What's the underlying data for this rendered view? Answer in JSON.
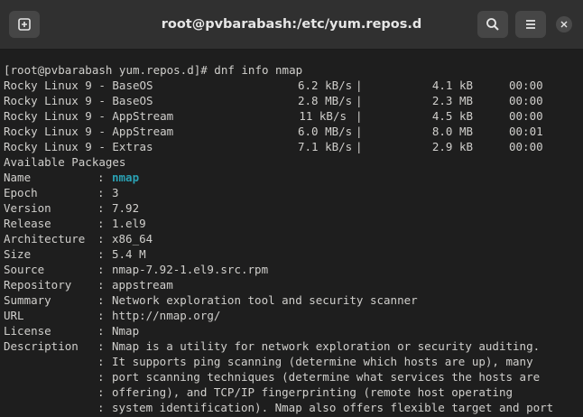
{
  "window": {
    "title": "root@pvbarabash:/etc/yum.repos.d"
  },
  "header_buttons": {
    "new_tab_icon": "new-tab-icon",
    "search_icon": "search-icon",
    "menu_icon": "hamburger-menu-icon",
    "close_icon": "close-icon"
  },
  "terminal": {
    "prompt_line": "[root@pvbarabash yum.repos.d]# dnf info nmap",
    "repos": [
      {
        "name": "Rocky Linux 9 - BaseOS",
        "speed": "6.2 kB/s",
        "sep": "|",
        "size": "4.1 kB",
        "time": "00:00"
      },
      {
        "name": "Rocky Linux 9 - BaseOS",
        "speed": "2.8 MB/s",
        "sep": "|",
        "size": "2.3 MB",
        "time": "00:00"
      },
      {
        "name": "Rocky Linux 9 - AppStream",
        "speed": "11 kB/s",
        "sep": "|",
        "size": "4.5 kB",
        "time": "00:00"
      },
      {
        "name": "Rocky Linux 9 - AppStream",
        "speed": "6.0 MB/s",
        "sep": "|",
        "size": "8.0 MB",
        "time": "00:01"
      },
      {
        "name": "Rocky Linux 9 - Extras",
        "speed": "7.1 kB/s",
        "sep": "|",
        "size": "2.9 kB",
        "time": "00:00"
      }
    ],
    "section_header": "Available Packages",
    "info": [
      {
        "key": "Name",
        "value": "nmap"
      },
      {
        "key": "Epoch",
        "value": "3"
      },
      {
        "key": "Version",
        "value": "7.92"
      },
      {
        "key": "Release",
        "value": "1.el9"
      },
      {
        "key": "Architecture",
        "value": "x86_64"
      },
      {
        "key": "Size",
        "value": "5.4 M"
      },
      {
        "key": "Source",
        "value": "nmap-7.92-1.el9.src.rpm"
      },
      {
        "key": "Repository",
        "value": "appstream"
      },
      {
        "key": "Summary",
        "value": "Network exploration tool and security scanner"
      },
      {
        "key": "URL",
        "value": "http://nmap.org/"
      },
      {
        "key": "License",
        "value": "Nmap"
      },
      {
        "key": "Description",
        "value": "Nmap is a utility for network exploration or security auditing."
      },
      {
        "key": "",
        "value": "It supports ping scanning (determine which hosts are up), many"
      },
      {
        "key": "",
        "value": "port scanning techniques (determine what services the hosts are"
      },
      {
        "key": "",
        "value": "offering), and TCP/IP fingerprinting (remote host operating"
      },
      {
        "key": "",
        "value": "system identification). Nmap also offers flexible target and port"
      }
    ],
    "colon": ":"
  },
  "colors": {
    "background": "#1e1e1e",
    "titlebar": "#303030",
    "text": "#d0cfcc",
    "highlight": "#2aa1b3"
  }
}
